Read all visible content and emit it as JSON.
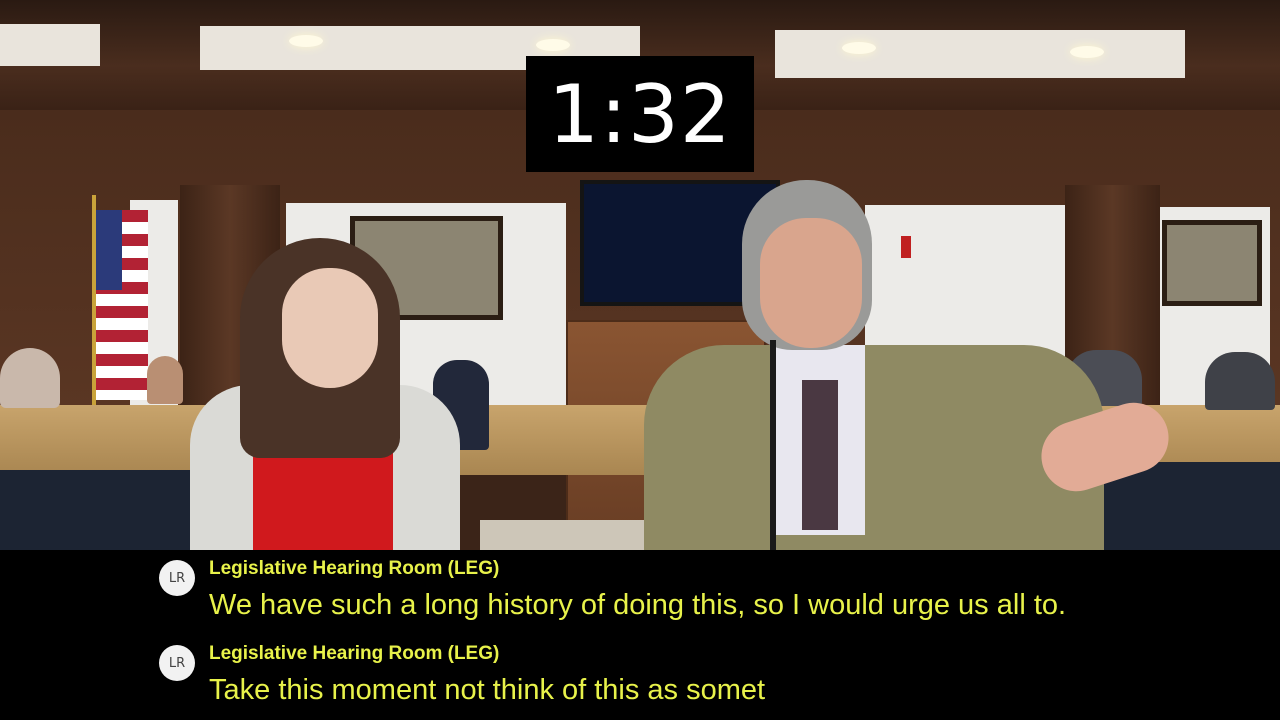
{
  "timer": {
    "text": "1:32"
  },
  "captions": [
    {
      "initials": "LR",
      "speaker": "Legislative Hearing Room (LEG)",
      "text": "We have such a long history of doing this, so I would urge us all to."
    },
    {
      "initials": "LR",
      "speaker": "Legislative Hearing Room (LEG)",
      "text": "Take this moment not think of this as somet"
    }
  ],
  "colors": {
    "caption_text": "#e8f24a",
    "caption_background": "#000000",
    "timer_text": "#ffffff"
  }
}
